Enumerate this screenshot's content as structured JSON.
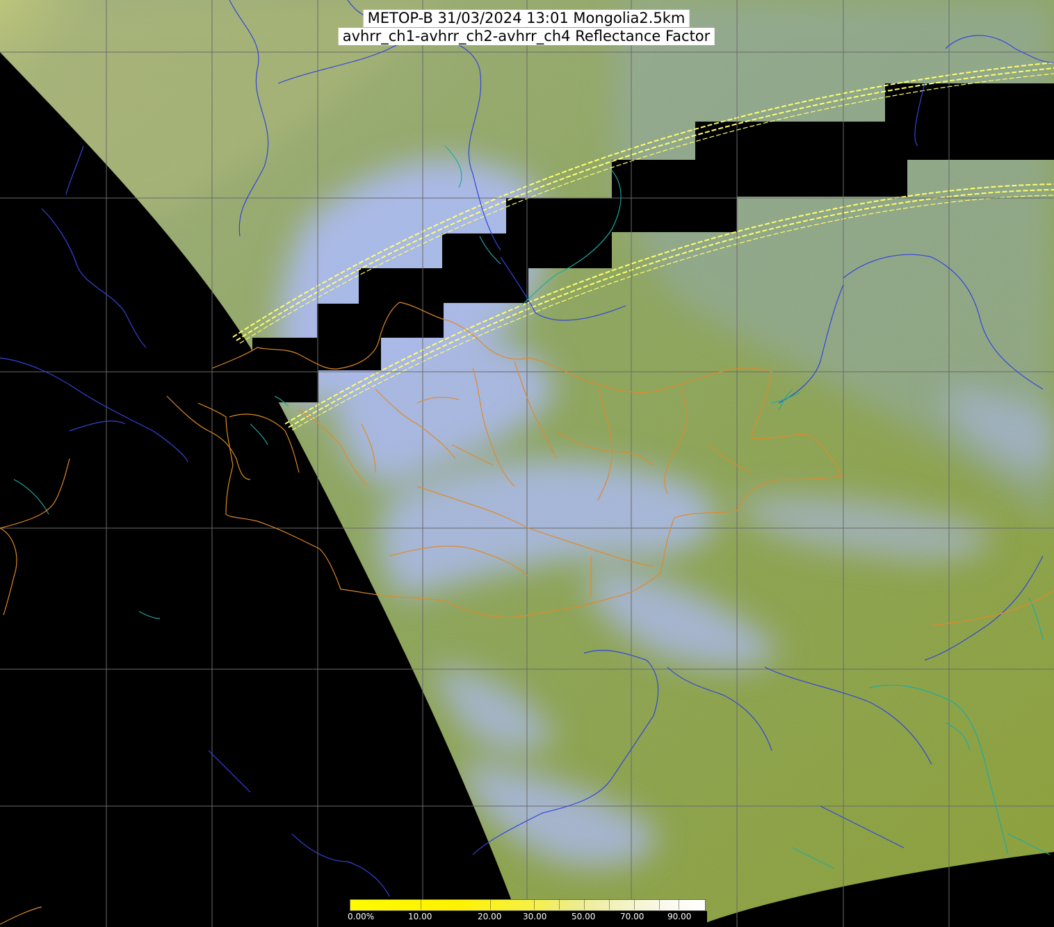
{
  "title": {
    "line1": "METOP-B 31/03/2024 13:01 Mongolia2.5km",
    "line2": "avhrr_ch1-avhrr_ch2-avhrr_ch4 Reflectance Factor"
  },
  "colorbar": {
    "labels": [
      "0.00%",
      "10.00",
      "20.00",
      "30.00",
      "50.00",
      "70.00",
      "90.00"
    ],
    "colors": [
      "#fffb00",
      "#f5f04a",
      "#ecec90",
      "#ffffff"
    ]
  },
  "map": {
    "no_data_color": "#000000",
    "land_color": "#7f9b3c",
    "cloud_color": "#a7b7ec",
    "boundary_color": "#e08a2a",
    "river_color": "#3344dd",
    "coast_color": "#20aaa0",
    "grid_color": "#6a6a6a",
    "swath_line_color": "#ffff55"
  }
}
